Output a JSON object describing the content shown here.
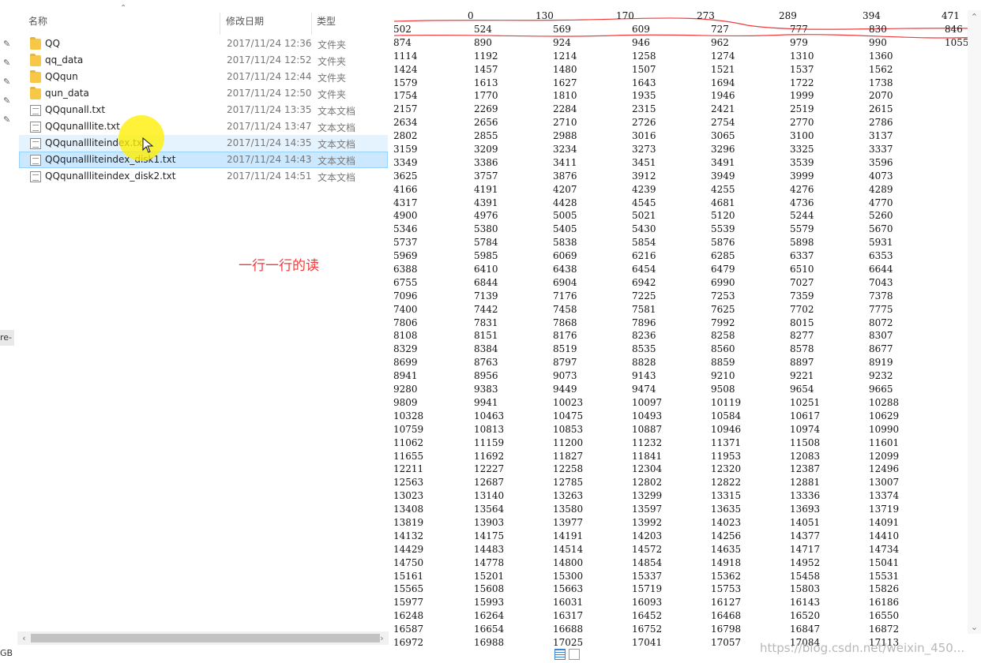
{
  "explorer": {
    "columns": {
      "name": "名称",
      "date": "修改日期",
      "type": "类型"
    },
    "files": [
      {
        "name": "QQ",
        "date": "2017/11/24 12:36",
        "type": "文件夹",
        "icon": "folder-icon"
      },
      {
        "name": "qq_data",
        "date": "2017/11/24 12:52",
        "type": "文件夹",
        "icon": "folder-icon"
      },
      {
        "name": "QQqun",
        "date": "2017/11/24 12:44",
        "type": "文件夹",
        "icon": "folder-icon"
      },
      {
        "name": "qun_data",
        "date": "2017/11/24 12:50",
        "type": "文件夹",
        "icon": "folder-icon"
      },
      {
        "name": "QQqunall.txt",
        "date": "2017/11/24 13:35",
        "type": "文本文档",
        "icon": "text-file-icon"
      },
      {
        "name": "QQqunalllite.txt",
        "date": "2017/11/24 13:47",
        "type": "文本文档",
        "icon": "text-file-icon"
      },
      {
        "name": "QQqunallliteindex.txt",
        "date": "2017/11/24 14:35",
        "type": "文本文档",
        "icon": "text-file-icon",
        "state": "hover"
      },
      {
        "name": "QQqunallliteindex_disk1.txt",
        "date": "2017/11/24 14:43",
        "type": "文本文档",
        "icon": "text-file-icon",
        "state": "selected"
      },
      {
        "name": "QQqunallliteindex_disk2.txt",
        "date": "2017/11/24 14:51",
        "type": "文本文档",
        "icon": "text-file-icon"
      }
    ],
    "annotation": "一行一行的读",
    "left_edge_text": "re-",
    "status_text": "GB"
  },
  "viewer": {
    "header": [
      "0",
      "130",
      "170",
      "273",
      "289",
      "394",
      "471"
    ],
    "rows": [
      [
        "502",
        "524",
        "569",
        "609",
        "727",
        "777",
        "830",
        "846"
      ],
      [
        "874",
        "890",
        "924",
        "946",
        "962",
        "979",
        "990",
        "1055"
      ],
      [
        "1114",
        "1192",
        "1214",
        "1258",
        "1274",
        "1310",
        "1360"
      ],
      [
        "1424",
        "1457",
        "1480",
        "1507",
        "1521",
        "1537",
        "1562"
      ],
      [
        "1579",
        "1613",
        "1627",
        "1643",
        "1694",
        "1722",
        "1738"
      ],
      [
        "1754",
        "1770",
        "1810",
        "1935",
        "1946",
        "1999",
        "2070"
      ],
      [
        "2157",
        "2269",
        "2284",
        "2315",
        "2421",
        "2519",
        "2615"
      ],
      [
        "2634",
        "2656",
        "2710",
        "2726",
        "2754",
        "2770",
        "2786"
      ],
      [
        "2802",
        "2855",
        "2988",
        "3016",
        "3065",
        "3100",
        "3137"
      ],
      [
        "3159",
        "3209",
        "3234",
        "3273",
        "3296",
        "3325",
        "3337"
      ],
      [
        "3349",
        "3386",
        "3411",
        "3451",
        "3491",
        "3539",
        "3596"
      ],
      [
        "3625",
        "3757",
        "3876",
        "3912",
        "3949",
        "3999",
        "4073"
      ],
      [
        "4166",
        "4191",
        "4207",
        "4239",
        "4255",
        "4276",
        "4289"
      ],
      [
        "4317",
        "4391",
        "4428",
        "4545",
        "4681",
        "4736",
        "4770"
      ],
      [
        "4900",
        "4976",
        "5005",
        "5021",
        "5120",
        "5244",
        "5260"
      ],
      [
        "5346",
        "5380",
        "5405",
        "5430",
        "5539",
        "5579",
        "5670"
      ],
      [
        "5737",
        "5784",
        "5838",
        "5854",
        "5876",
        "5898",
        "5931"
      ],
      [
        "5969",
        "5985",
        "6069",
        "6216",
        "6285",
        "6337",
        "6353"
      ],
      [
        "6388",
        "6410",
        "6438",
        "6454",
        "6479",
        "6510",
        "6644"
      ],
      [
        "6755",
        "6844",
        "6904",
        "6942",
        "6990",
        "7027",
        "7043"
      ],
      [
        "7096",
        "7139",
        "7176",
        "7225",
        "7253",
        "7359",
        "7378"
      ],
      [
        "7400",
        "7442",
        "7458",
        "7581",
        "7625",
        "7702",
        "7775"
      ],
      [
        "7806",
        "7831",
        "7868",
        "7896",
        "7992",
        "8015",
        "8072"
      ],
      [
        "8108",
        "8151",
        "8176",
        "8236",
        "8258",
        "8277",
        "8307"
      ],
      [
        "8329",
        "8384",
        "8519",
        "8535",
        "8560",
        "8578",
        "8677"
      ],
      [
        "8699",
        "8763",
        "8797",
        "8828",
        "8859",
        "8897",
        "8919"
      ],
      [
        "8941",
        "8956",
        "9073",
        "9143",
        "9210",
        "9221",
        "9232"
      ],
      [
        "9280",
        "9383",
        "9449",
        "9474",
        "9508",
        "9654",
        "9665"
      ],
      [
        "9809",
        "9941",
        "10023",
        "10097",
        "10119",
        "10251",
        "10288"
      ],
      [
        "10328",
        "10463",
        "10475",
        "10493",
        "10584",
        "10617",
        "10629"
      ],
      [
        "10759",
        "10813",
        "10853",
        "10887",
        "10946",
        "10974",
        "10990"
      ],
      [
        "11062",
        "11159",
        "11200",
        "11232",
        "11371",
        "11508",
        "11601"
      ],
      [
        "11655",
        "11692",
        "11827",
        "11841",
        "11953",
        "12083",
        "12099"
      ],
      [
        "12211",
        "12227",
        "12258",
        "12304",
        "12320",
        "12387",
        "12496"
      ],
      [
        "12563",
        "12687",
        "12785",
        "12802",
        "12822",
        "12881",
        "13007"
      ],
      [
        "13023",
        "13140",
        "13263",
        "13299",
        "13315",
        "13336",
        "13374"
      ],
      [
        "13408",
        "13564",
        "13580",
        "13597",
        "13635",
        "13693",
        "13719"
      ],
      [
        "13819",
        "13903",
        "13977",
        "13992",
        "14023",
        "14051",
        "14091"
      ],
      [
        "14132",
        "14175",
        "14191",
        "14203",
        "14256",
        "14377",
        "14410"
      ],
      [
        "14429",
        "14483",
        "14514",
        "14572",
        "14635",
        "14717",
        "14734"
      ],
      [
        "14750",
        "14778",
        "14800",
        "14854",
        "14918",
        "14952",
        "15041"
      ],
      [
        "15161",
        "15201",
        "15300",
        "15337",
        "15362",
        "15458",
        "15531"
      ],
      [
        "15565",
        "15608",
        "15663",
        "15719",
        "15753",
        "15803",
        "15826"
      ],
      [
        "15977",
        "15993",
        "16031",
        "16093",
        "16127",
        "16143",
        "16186"
      ],
      [
        "16248",
        "16264",
        "16317",
        "16452",
        "16468",
        "16520",
        "16550"
      ],
      [
        "16587",
        "16654",
        "16688",
        "16752",
        "16798",
        "16847",
        "16872"
      ],
      [
        "16972",
        "16988",
        "17025",
        "17041",
        "17057",
        "17084",
        "17113"
      ]
    ],
    "watermark": "https://blog.csdn.net/weixin_450..."
  },
  "colors": {
    "selected_row": "#cce8ff",
    "hover_row": "#e5f3ff",
    "annotation_red": "#ef3b3b",
    "cursor_highlight": "#ffee00"
  }
}
